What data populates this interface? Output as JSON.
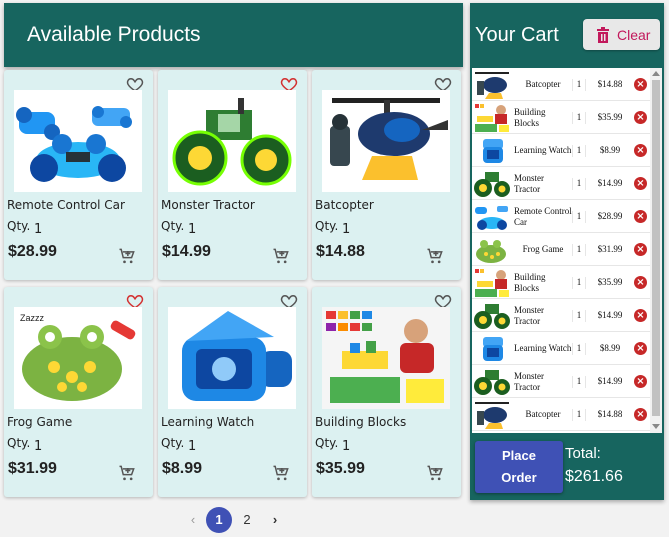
{
  "products": {
    "title": "Available Products",
    "qty_label": "Qty.",
    "items": [
      {
        "name": "Remote Control Car",
        "qty": "1",
        "price": "$28.99",
        "favorite": false
      },
      {
        "name": "Monster Tractor",
        "qty": "1",
        "price": "$14.99",
        "favorite": true
      },
      {
        "name": "Batcopter",
        "qty": "1",
        "price": "$14.88",
        "favorite": false
      },
      {
        "name": "Frog Game",
        "qty": "1",
        "price": "$31.99",
        "favorite": true
      },
      {
        "name": "Learning Watch",
        "qty": "1",
        "price": "$8.99",
        "favorite": false
      },
      {
        "name": "Building Blocks",
        "qty": "1",
        "price": "$35.99",
        "favorite": false
      }
    ],
    "pagination": {
      "prev": "‹",
      "pages": [
        "1",
        "2"
      ],
      "current": "1",
      "next": "›"
    }
  },
  "cart": {
    "title": "Your Cart",
    "clear_label": "Clear",
    "items": [
      {
        "name": "Batcopter",
        "qty": "1",
        "price": "$14.88"
      },
      {
        "name": "Building Blocks",
        "qty": "1",
        "price": "$35.99"
      },
      {
        "name": "Learning Watch",
        "qty": "1",
        "price": "$8.99"
      },
      {
        "name": "Monster Tractor",
        "qty": "1",
        "price": "$14.99"
      },
      {
        "name": "Remote Control Car",
        "qty": "1",
        "price": "$28.99"
      },
      {
        "name": "Frog Game",
        "qty": "1",
        "price": "$31.99"
      },
      {
        "name": "Building Blocks",
        "qty": "1",
        "price": "$35.99"
      },
      {
        "name": "Monster Tractor",
        "qty": "1",
        "price": "$14.99"
      },
      {
        "name": "Learning Watch",
        "qty": "1",
        "price": "$8.99"
      },
      {
        "name": "Monster Tractor",
        "qty": "1",
        "price": "$14.99"
      },
      {
        "name": "Batcopter",
        "qty": "1",
        "price": "$14.88"
      }
    ],
    "place_order_line1": "Place",
    "place_order_line2": "Order",
    "total_label": "Total:",
    "total_value": "$261.66"
  },
  "colors": {
    "header": "#17655f",
    "card": "#dcf1f1",
    "accent": "#3f51b5",
    "danger": "#c62828",
    "favorite": "#d32f2f"
  },
  "icons": [
    "heart-outline-icon",
    "heart-icon",
    "add-cart-icon",
    "trash-icon",
    "remove-circle-icon",
    "chevron-left-icon",
    "chevron-right-icon"
  ]
}
